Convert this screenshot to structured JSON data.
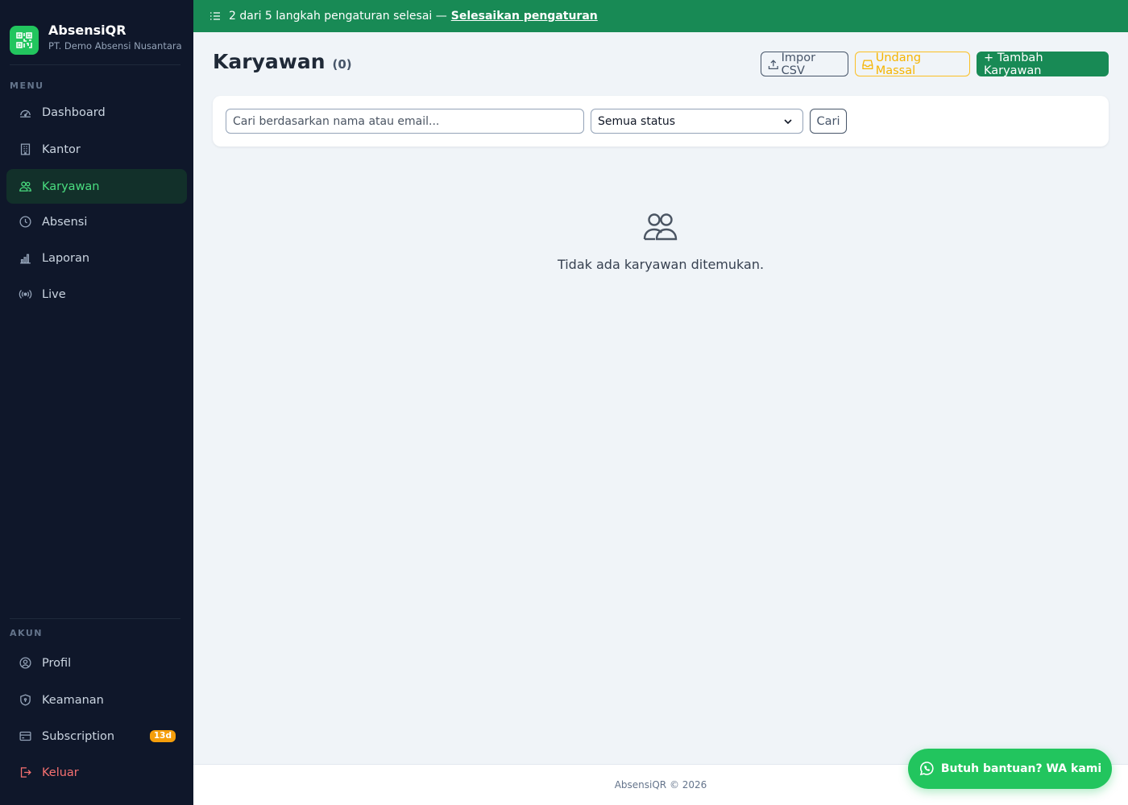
{
  "brand": {
    "name": "AbsensiQR",
    "company": "PT. Demo Absensi Nusantara"
  },
  "sidebar": {
    "menu_label": "MENU",
    "items": [
      {
        "label": "Dashboard",
        "icon": "dashboard-gauge-icon"
      },
      {
        "label": "Kantor",
        "icon": "building-icon"
      },
      {
        "label": "Karyawan",
        "icon": "users-icon",
        "active": true
      },
      {
        "label": "Absensi",
        "icon": "clock-icon"
      },
      {
        "label": "Laporan",
        "icon": "bar-chart-icon"
      },
      {
        "label": "Live",
        "icon": "broadcast-icon"
      }
    ],
    "account_label": "AKUN",
    "account_items": [
      {
        "label": "Profil",
        "icon": "user-circle-icon"
      },
      {
        "label": "Keamanan",
        "icon": "shield-icon"
      },
      {
        "label": "Subscription",
        "icon": "credit-card-icon",
        "badge": "13d"
      },
      {
        "label": "Keluar",
        "icon": "logout-icon"
      }
    ]
  },
  "banner": {
    "text": "2 dari 5 langkah pengaturan selesai —",
    "link": "Selesaikan pengaturan"
  },
  "page": {
    "title": "Karyawan",
    "count": "(0)"
  },
  "actions": {
    "import": "Impor CSV",
    "invite": "Undang Massal",
    "add": "+ Tambah Karyawan"
  },
  "filters": {
    "search_placeholder": "Cari berdasarkan nama atau email...",
    "search_value": "",
    "status_selected": "Semua status",
    "search_button": "Cari"
  },
  "empty_state": {
    "message": "Tidak ada karyawan ditemukan."
  },
  "footer": {
    "text": "AbsensiQR © 2026"
  },
  "help_button": {
    "label": "Butuh bantuan? WA kami"
  },
  "colors": {
    "sidebar_bg": "#0f172a",
    "brand_green": "#188a55",
    "accent_green": "#22c55e",
    "active_text": "#4ade80",
    "warning": "#f59e0b",
    "danger": "#f87171"
  }
}
